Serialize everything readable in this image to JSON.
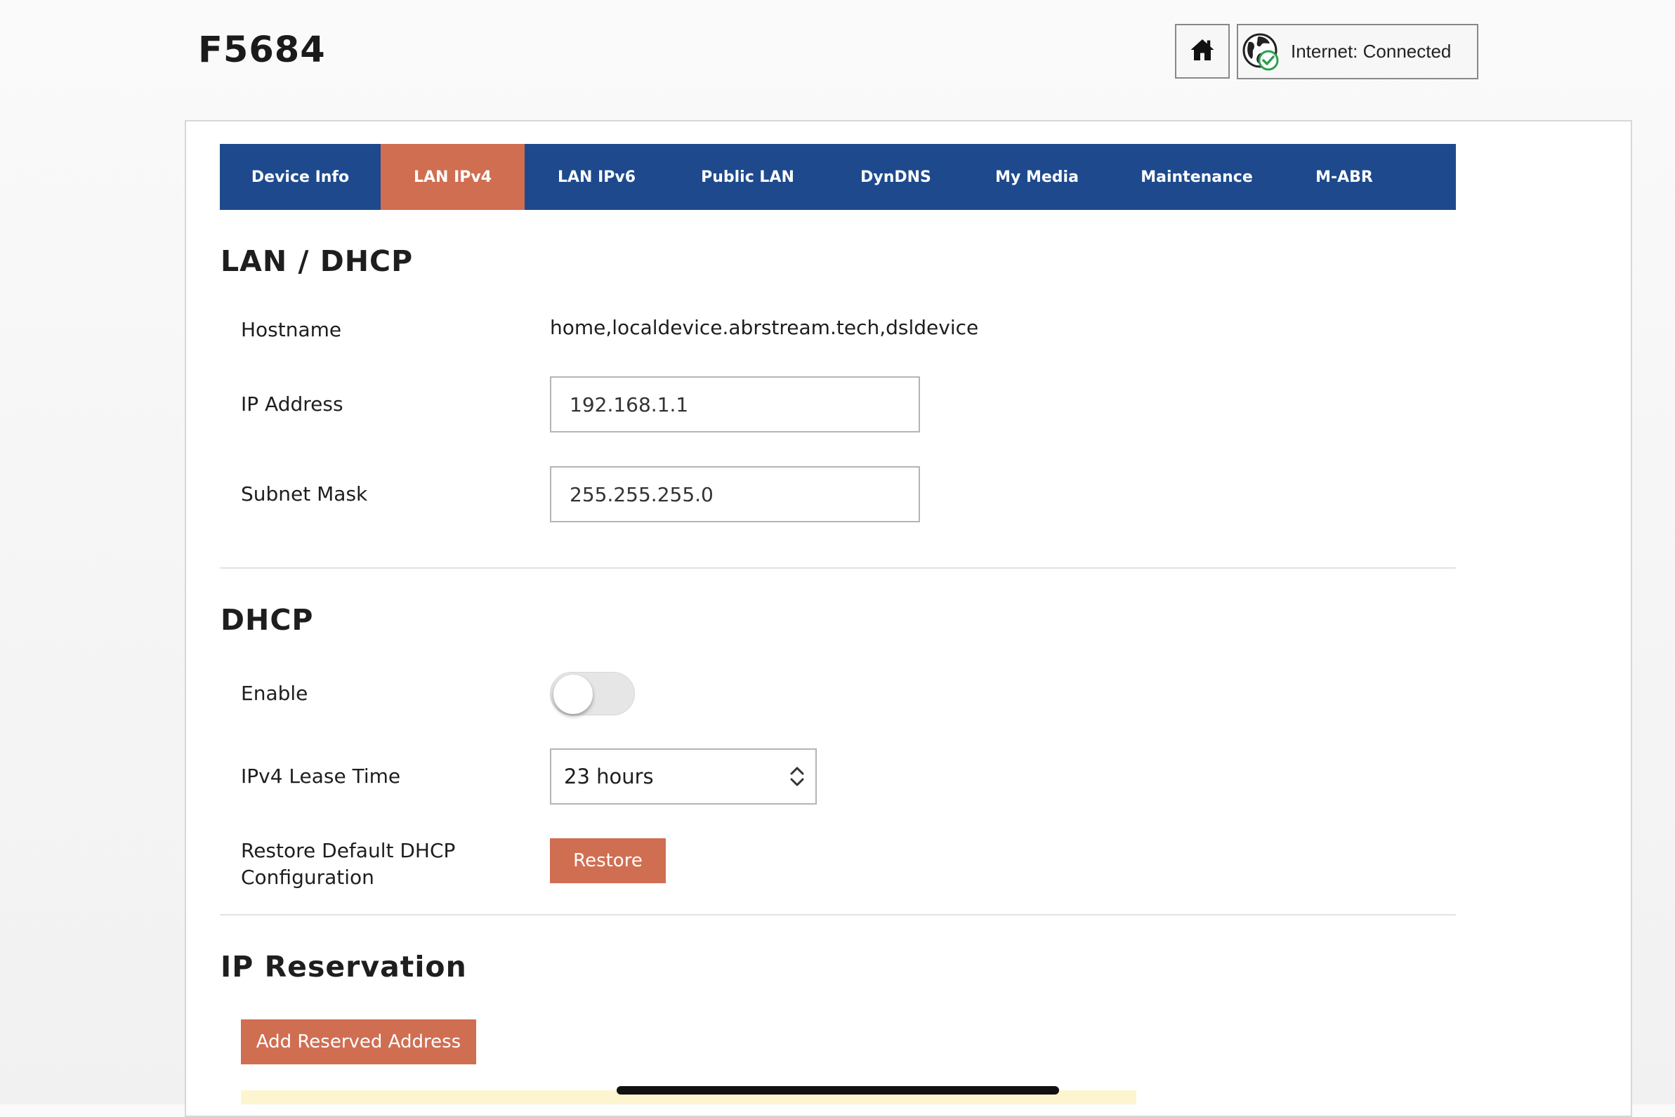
{
  "header": {
    "brand": "F5684",
    "internet_status": "Internet: Connected"
  },
  "tabs": [
    {
      "label": "Device Info",
      "active": false
    },
    {
      "label": "LAN IPv4",
      "active": true
    },
    {
      "label": "LAN IPv6",
      "active": false
    },
    {
      "label": "Public LAN",
      "active": false
    },
    {
      "label": "DynDNS",
      "active": false
    },
    {
      "label": "My Media",
      "active": false
    },
    {
      "label": "Maintenance",
      "active": false
    },
    {
      "label": "M-ABR",
      "active": false
    }
  ],
  "lan_dhcp": {
    "title": "LAN / DHCP",
    "hostname_label": "Hostname",
    "hostname_value": "home,localdevice.abrstream.tech,dsldevice",
    "ip_label": "IP Address",
    "ip_value": "192.168.1.1",
    "subnet_label": "Subnet Mask",
    "subnet_value": "255.255.255.0"
  },
  "dhcp": {
    "title": "DHCP",
    "enable_label": "Enable",
    "enabled": false,
    "lease_label": "IPv4 Lease Time",
    "lease_value": "23 hours",
    "restore_label_line1": "Restore Default DHCP",
    "restore_label_line2": "Configuration",
    "restore_button": "Restore"
  },
  "ip_reservation": {
    "title": "IP Reservation",
    "add_button": "Add Reserved Address"
  },
  "colors": {
    "nav_blue": "#1e4a8d",
    "accent_orange": "#d06e52",
    "connected_green": "#2e9e4f"
  },
  "icons": {
    "home": "home-icon",
    "internet": "globe-check-icon",
    "select": "chevron-up-down-icon"
  }
}
